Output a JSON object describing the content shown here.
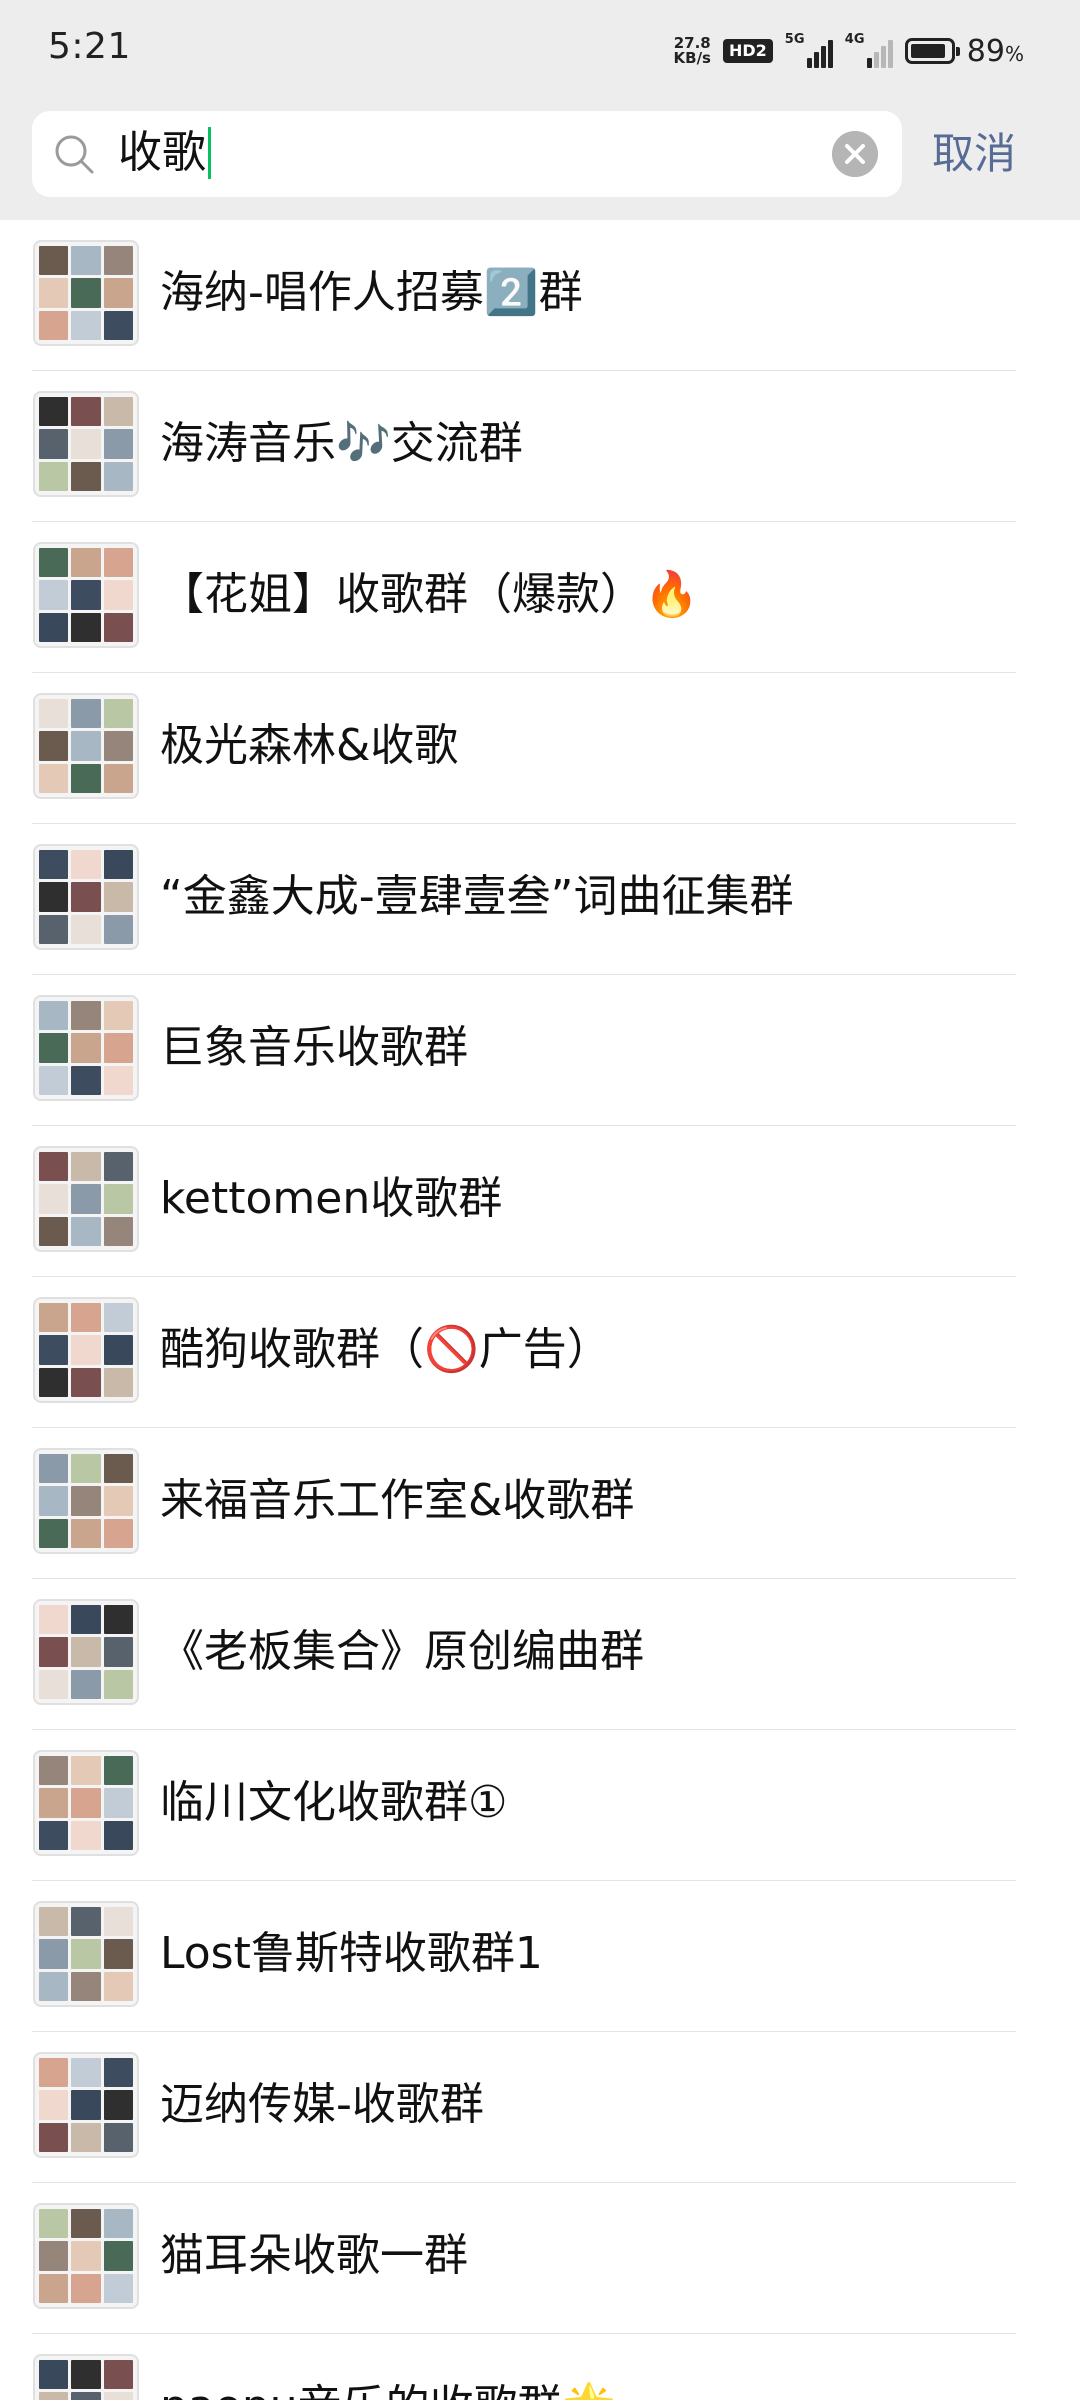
{
  "status_bar": {
    "time": "5:21",
    "netspeed_value": "27.8",
    "netspeed_unit": "KB/s",
    "hd_badge": "HD2",
    "signal_1_tag": "5G",
    "signal_2_tag": "4G",
    "battery_percent": "89",
    "battery_unit": "%",
    "battery_level": 0.89
  },
  "search": {
    "query": "收歌",
    "cancel_label": "取消"
  },
  "results": [
    {
      "title": "海纳-唱作人招募2️⃣群"
    },
    {
      "title": "海涛音乐🎶交流群"
    },
    {
      "title": "【花姐】收歌群（爆款）🔥"
    },
    {
      "title": "极光森林&收歌"
    },
    {
      "title": "“金鑫大成-壹肆壹叁”词曲征集群"
    },
    {
      "title": "巨象音乐收歌群"
    },
    {
      "title": "kettomen收歌群"
    },
    {
      "title": "酷狗收歌群（🚫广告）"
    },
    {
      "title": "来福音乐工作室&收歌群"
    },
    {
      "title": "《老板集合》原创编曲群"
    },
    {
      "title": "临川文化收歌群①"
    },
    {
      "title": "Lost鲁斯特收歌群1"
    },
    {
      "title": "迈纳传媒-收歌群"
    },
    {
      "title": "猫耳朵收歌一群"
    },
    {
      "title": "paopu音乐的收歌群🌟"
    }
  ]
}
